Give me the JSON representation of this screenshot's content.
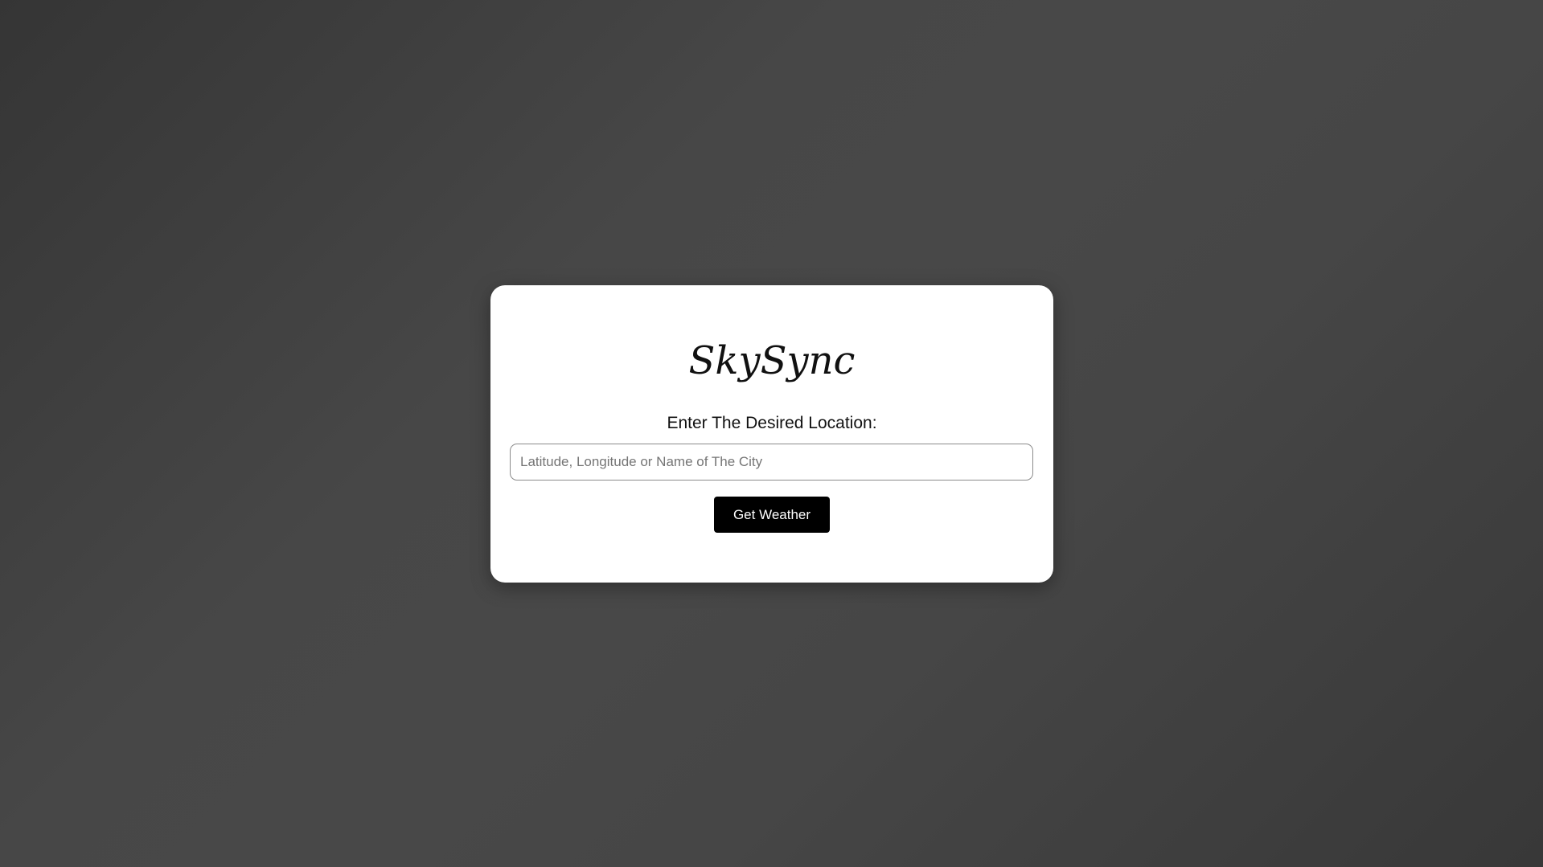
{
  "app": {
    "logo_text": "SkySync"
  },
  "form": {
    "prompt_label": "Enter The Desired Location:",
    "location_value": "",
    "location_placeholder": "Latitude, Longitude or Name of The City",
    "submit_label": "Get Weather"
  },
  "colors": {
    "background": "#424242",
    "card": "#ffffff",
    "button": "#000000",
    "button_text": "#ffffff"
  }
}
